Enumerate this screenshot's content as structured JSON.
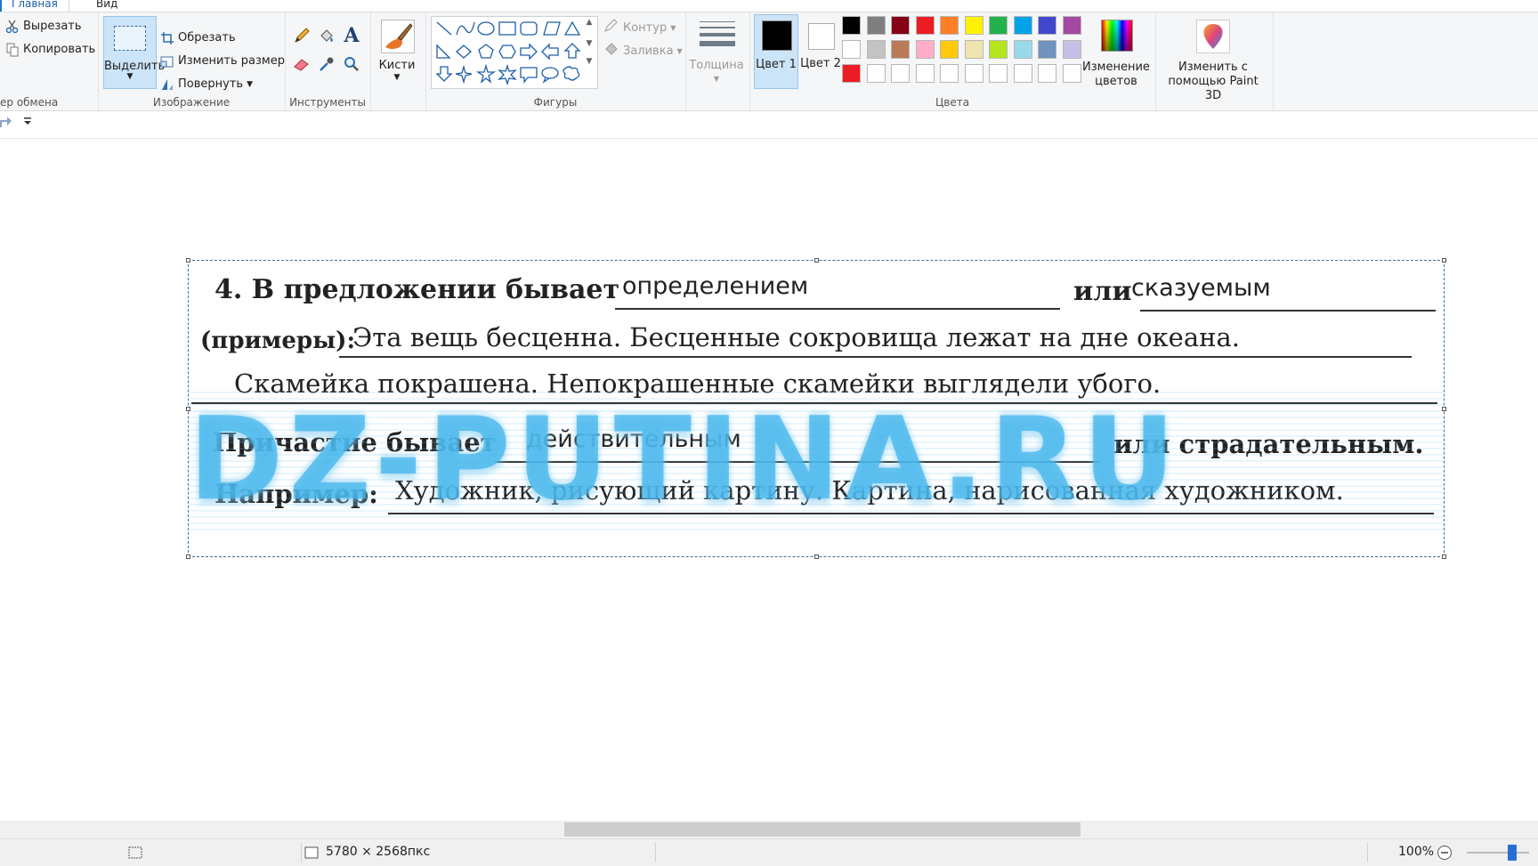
{
  "tabs": {
    "home": "Главная",
    "view": "Вид"
  },
  "clipboard": {
    "cut": "Вырезать",
    "copy": "Копировать",
    "group": "ер обмена"
  },
  "image_group": {
    "select": "Выделить",
    "crop": "Обрезать",
    "resize": "Изменить размер",
    "rotate": "Повернуть",
    "group": "Изображение"
  },
  "tools_group": {
    "group": "Инструменты",
    "text_tool_glyph": "A"
  },
  "brushes": {
    "label": "Кисти"
  },
  "shapes": {
    "outline": "Контур",
    "fill": "Заливка",
    "group": "Фигуры"
  },
  "thickness": {
    "label": "Толщина"
  },
  "colors": {
    "color1_label": "Цвет 1",
    "color2_label": "Цвет 2",
    "color1": "#000000",
    "color2": "#ffffff",
    "edit_colors": "Изменение цветов",
    "group": "Цвета",
    "palette": [
      "#000000",
      "#7f7f7f",
      "#880015",
      "#ed1c24",
      "#ff7f27",
      "#fff200",
      "#22b14c",
      "#00a2e8",
      "#3f48cc",
      "#a349a4",
      "#ffffff",
      "#c3c3c3",
      "#b97a57",
      "#ffaec9",
      "#ffc90e",
      "#efe4b0",
      "#b5e61d",
      "#99d9ea",
      "#7092be",
      "#c8bfe7",
      "#ed1c24",
      "#ffffff",
      "#ffffff",
      "#ffffff",
      "#ffffff",
      "#ffffff",
      "#ffffff",
      "#ffffff",
      "#ffffff",
      "#ffffff"
    ]
  },
  "paint3d": {
    "label": "Изменить с помощью Paint 3D"
  },
  "document": {
    "l1_a": "4. В предложении бывает",
    "l1_ans1": "определением",
    "l1_or": "или",
    "l1_ans2": "сказуемым",
    "l2_a": "(примеры):",
    "l2_text": "Эта вещь бесценна. Бесценные сокровища лежат на дне океана.",
    "l3_text": "Скамейка покрашена. Непокрашенные скамейки выглядели убого.",
    "l4_a": "Причастие бывает",
    "l4_ans1": "действительным",
    "l4_b": "или страдательным.",
    "l5_a": "Например:",
    "l5_text": "Художник, рисующий картину. Картина, нарисованная художником.",
    "watermark": "DZ-PUTINA.RU"
  },
  "status": {
    "dimensions": "5780 × 2568пкс",
    "zoom": "100%"
  }
}
